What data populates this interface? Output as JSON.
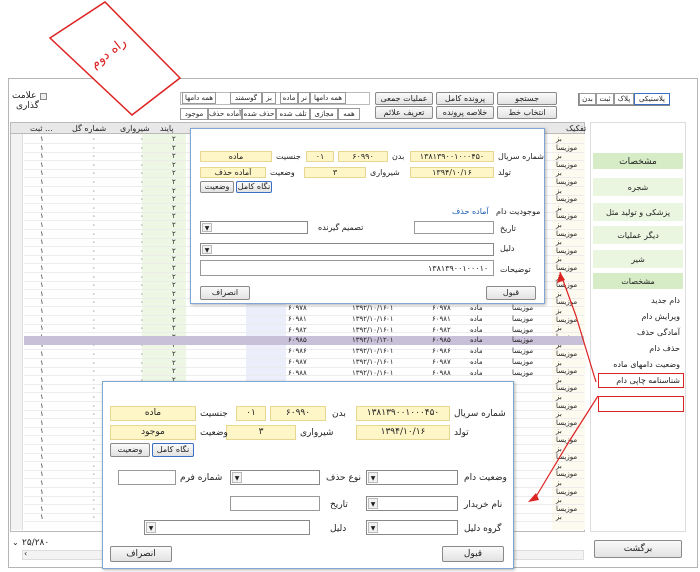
{
  "annotation": {
    "label": "راه دوم"
  },
  "top_left": {
    "mark_label": "علامت",
    "mark_label2": "گذاری"
  },
  "toolbar_row1": [
    {
      "id": "all_livestock",
      "label": "همه دامها"
    },
    {
      "id": "sheep",
      "label": "گوسفند"
    },
    {
      "id": "goat",
      "label": "بز"
    },
    {
      "id": "all_animals",
      "label": "همه دامها"
    },
    {
      "id": "ram",
      "label": "نر"
    },
    {
      "id": "female",
      "label": "ماده"
    }
  ],
  "toolbar_row2": [
    {
      "id": "present",
      "label": "موجود"
    },
    {
      "id": "ready_removal",
      "label": "آماده حذف"
    },
    {
      "id": "removed",
      "label": "حذف شده"
    },
    {
      "id": "dead",
      "label": "تلف شده"
    },
    {
      "id": "virtual",
      "label": "مجازی"
    },
    {
      "id": "all",
      "label": "همه"
    }
  ],
  "toolbar_buttons": [
    {
      "id": "group_ops",
      "label": "عملیات جمعی"
    },
    {
      "id": "define_marks",
      "label": "تعریف علائم"
    },
    {
      "id": "full_file",
      "label": "پرونده کامل"
    },
    {
      "id": "file_summary",
      "label": "خلاصه پرونده"
    },
    {
      "id": "search",
      "label": "جستجو"
    },
    {
      "id": "select_line",
      "label": "انتخاب خط"
    }
  ],
  "top_right_tabs": [
    "پلاستیکی",
    "پلاک",
    "ثبت",
    "بدن"
  ],
  "grid_headers": {
    "register": "ثبت ...",
    "flower_no": "شماره گل",
    "milk": "شیرواری",
    "pattern": "پایند",
    "breed": "تفکیک"
  },
  "grid_values": {
    "register": "۱",
    "flower_no": "۰",
    "milk": "۰",
    "pattern": "۲",
    "breed": "بز",
    "breed2": "موزیسا"
  },
  "grid_rows_mid": [
    {
      "a": "۶۰۹۷۸",
      "b": "۱۳۹۲/۱۰/۱۶",
      "c": "۰۱",
      "d": "۶۰۹۷۸",
      "e": "ماده",
      "f": "موزیسا"
    },
    {
      "a": "۶۰۹۸۱",
      "b": "۱۳۹۲/۱۰/۱۶",
      "c": "۰۱",
      "d": "۶۰۹۸۱",
      "e": "ماده",
      "f": "موزیسا"
    },
    {
      "a": "۶۰۹۸۲",
      "b": "۱۳۹۲/۱۰/۱۶",
      "c": "۰۱",
      "d": "۶۰۹۸۲",
      "e": "ماده",
      "f": "موزیسا"
    },
    {
      "a": "۶۰۹۸۵",
      "b": "۱۳۹۲/۱۰/۱۲",
      "c": "۰۱",
      "d": "۶۰۹۸۵",
      "e": "ماده",
      "f": "موزیسا"
    },
    {
      "a": "۶۰۹۸۶",
      "b": "۱۳۹۲/۱۰/۱۶",
      "c": "۰۱",
      "d": "۶۰۹۸۶",
      "e": "ماده",
      "f": "موزیسا"
    },
    {
      "a": "۶۰۹۸۷",
      "b": "۱۳۹۲/۱۰/۱۶",
      "c": "۰۱",
      "d": "۶۰۹۸۷",
      "e": "ماده",
      "f": "موزیسا"
    },
    {
      "a": "۶۰۹۸۸",
      "b": "۱۳۹۲/۱۰/۱۶",
      "c": "۰۱",
      "d": "۶۰۹۸۸",
      "e": "ماده",
      "f": "موزیسا"
    }
  ],
  "status_count": "۲۵/۲۸۰",
  "side_menu": [
    {
      "id": "specs_header",
      "label": "مشخصات"
    },
    {
      "id": "pedigree",
      "label": "شجره"
    },
    {
      "id": "medical",
      "label": "پزشکی و تولید مثل"
    },
    {
      "id": "other_ops",
      "label": "دیگر عملیات"
    },
    {
      "id": "milk",
      "label": "شیر"
    },
    {
      "id": "specs",
      "label": "مشخصات"
    },
    {
      "id": "new_animal",
      "label": "دام جدید"
    },
    {
      "id": "edit_animal",
      "label": "ویرایش دام"
    },
    {
      "id": "ready_remove",
      "label": "آمادگی حذف"
    },
    {
      "id": "remove_animal",
      "label": "حذف دام"
    },
    {
      "id": "female_status",
      "label": "وضعیت دامهای ماده"
    },
    {
      "id": "print_id",
      "label": "شناسنامه چاپی دام"
    }
  ],
  "back_button": "برگشت",
  "dlg1": {
    "serial_label": "شماره سریال",
    "serial": "۱۳۸۱۳۹۰۰۱۰۰۰۴۵۰",
    "body_label": "بدن",
    "body": "۶۰۹۹۰",
    "gender_label": "جنسیت",
    "gender_code": "۰۱",
    "gender": "ماده",
    "birth_label": "تولد",
    "birth": "۱۳۹۴/۱۰/۱۶",
    "milk_label": "شیرواری",
    "milk": "۳",
    "status_label": "وضعیت",
    "status": "آماده حذف",
    "btn_full": "نگاه کامل",
    "btn_status": "وضعیت",
    "availability_label": "موجودیت دام",
    "availability_value": "آماده حذف",
    "date_label": "تاریخ",
    "decider_label": "تصمیم گیرنده",
    "reason_label": "دلیل",
    "desc_label": "توضیحات",
    "desc_value": "۱۳۸۱۳۹۰۰۱۰۰۰۱۰",
    "accept": "قبول",
    "cancel": "انصراف"
  },
  "dlg2": {
    "serial_label": "شماره سریال",
    "serial": "۱۳۸۱۳۹۰۰۱۰۰۰۴۵۰",
    "body_label": "بدن",
    "body": "۶۰۹۹۰",
    "gender_label": "جنسیت",
    "gender_code": "۰۱",
    "gender": "ماده",
    "birth_label": "تولد",
    "birth": "۱۳۹۴/۱۰/۱۶",
    "milk_label": "شیرواری",
    "milk": "۳",
    "status_label": "وضعیت",
    "status": "موجود",
    "btn_full": "نگاه کامل",
    "btn_status": "وضعیت",
    "animal_status_label": "وضعیت دام",
    "removal_type_label": "نوع حذف",
    "form_no_label": "شماره فرم",
    "buyer_label": "نام خریدار",
    "date_label": "تاریخ",
    "reason_group_label": "گروه دلیل",
    "reason_label": "دلیل",
    "accept": "قبول",
    "cancel": "انصراف"
  }
}
